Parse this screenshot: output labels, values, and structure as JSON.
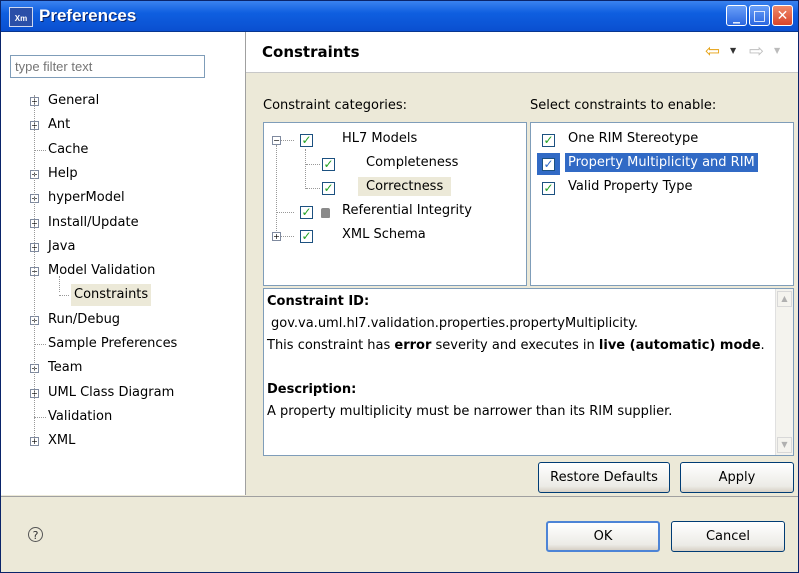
{
  "window": {
    "title": "Preferences",
    "app_icon": "X",
    "app_icon_sub": "m",
    "min": "_",
    "max": "□",
    "close": "✕"
  },
  "filter": {
    "placeholder": "type filter text"
  },
  "tree": [
    {
      "label": "General",
      "expander": "+"
    },
    {
      "label": "Ant",
      "expander": "+"
    },
    {
      "label": "Cache",
      "expander": ""
    },
    {
      "label": "Help",
      "expander": "+"
    },
    {
      "label": "hyperModel",
      "expander": "+"
    },
    {
      "label": "Install/Update",
      "expander": "+"
    },
    {
      "label": "Java",
      "expander": "+"
    },
    {
      "label": "Model Validation",
      "expander": "−"
    },
    {
      "label": "Constraints",
      "expander": "",
      "selected": true
    },
    {
      "label": "Run/Debug",
      "expander": "+"
    },
    {
      "label": "Sample Preferences",
      "expander": ""
    },
    {
      "label": "Team",
      "expander": "+"
    },
    {
      "label": "UML Class Diagram",
      "expander": "+"
    },
    {
      "label": "Validation",
      "expander": ""
    },
    {
      "label": "XML",
      "expander": "+"
    }
  ],
  "page": {
    "title": "Constraints",
    "back_icon": "⇦",
    "forward_icon": "⇨",
    "dropdown_icon": "▼",
    "categories_label": "Constraint categories:",
    "constraints_label": "Select constraints to enable:",
    "categories": [
      {
        "label": "HL7 Models",
        "checked": true,
        "expander": "−"
      },
      {
        "label": "Completeness",
        "checked": true
      },
      {
        "label": "Correctness",
        "checked": true,
        "selected": true
      },
      {
        "label": "Referential Integrity",
        "checked": true
      },
      {
        "label": "XML Schema",
        "checked": true,
        "expander": "+"
      }
    ],
    "constraints": [
      {
        "label": "One RIM Stereotype",
        "checked": true
      },
      {
        "label": "Property Multiplicity and RIM",
        "checked": true,
        "selected": true
      },
      {
        "label": "Valid Property Type",
        "checked": true
      }
    ],
    "detail": {
      "id_heading": "Constraint ID:",
      "id_value": "gov.va.uml.hl7.validation.properties.propertyMultiplicity.",
      "sev_prefix": "This constraint has ",
      "sev_value": "error",
      "sev_middle": " severity and executes in ",
      "mode_value": "live (automatic) mode",
      "sev_suffix": ".",
      "desc_heading": "Description:",
      "desc_value": "A property multiplicity must be narrower than its RIM supplier."
    },
    "restore_label": "Restore Defaults",
    "apply_label": "Apply"
  },
  "footer": {
    "help_icon": "?",
    "ok_label": "OK",
    "cancel_label": "Cancel"
  }
}
